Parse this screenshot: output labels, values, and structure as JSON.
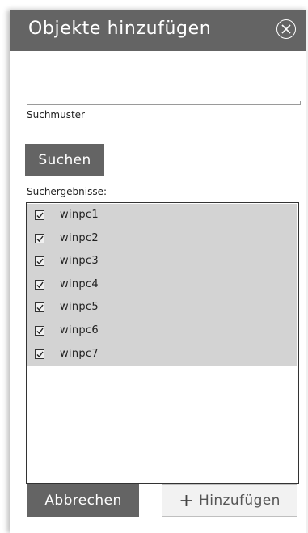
{
  "dialog": {
    "title": "Objekte hinzufügen",
    "close_icon": "close-circle-icon"
  },
  "search": {
    "value": "",
    "placeholder": "",
    "label": "Suchmuster",
    "button_label": "Suchen"
  },
  "results": {
    "label": "Suchergebnisse:",
    "items": [
      {
        "label": "winpc1",
        "checked": true
      },
      {
        "label": "winpc2",
        "checked": true
      },
      {
        "label": "winpc3",
        "checked": true
      },
      {
        "label": "winpc4",
        "checked": true
      },
      {
        "label": "winpc5",
        "checked": true
      },
      {
        "label": "winpc6",
        "checked": true
      },
      {
        "label": "winpc7",
        "checked": true
      }
    ]
  },
  "footer": {
    "cancel_label": "Abbrechen",
    "add_label": "Hinzufügen",
    "add_icon": "plus-icon"
  },
  "colors": {
    "header": "#646464",
    "selection": "#d3d3d3",
    "button_dark": "#646464",
    "button_light": "#f2f2f2"
  }
}
